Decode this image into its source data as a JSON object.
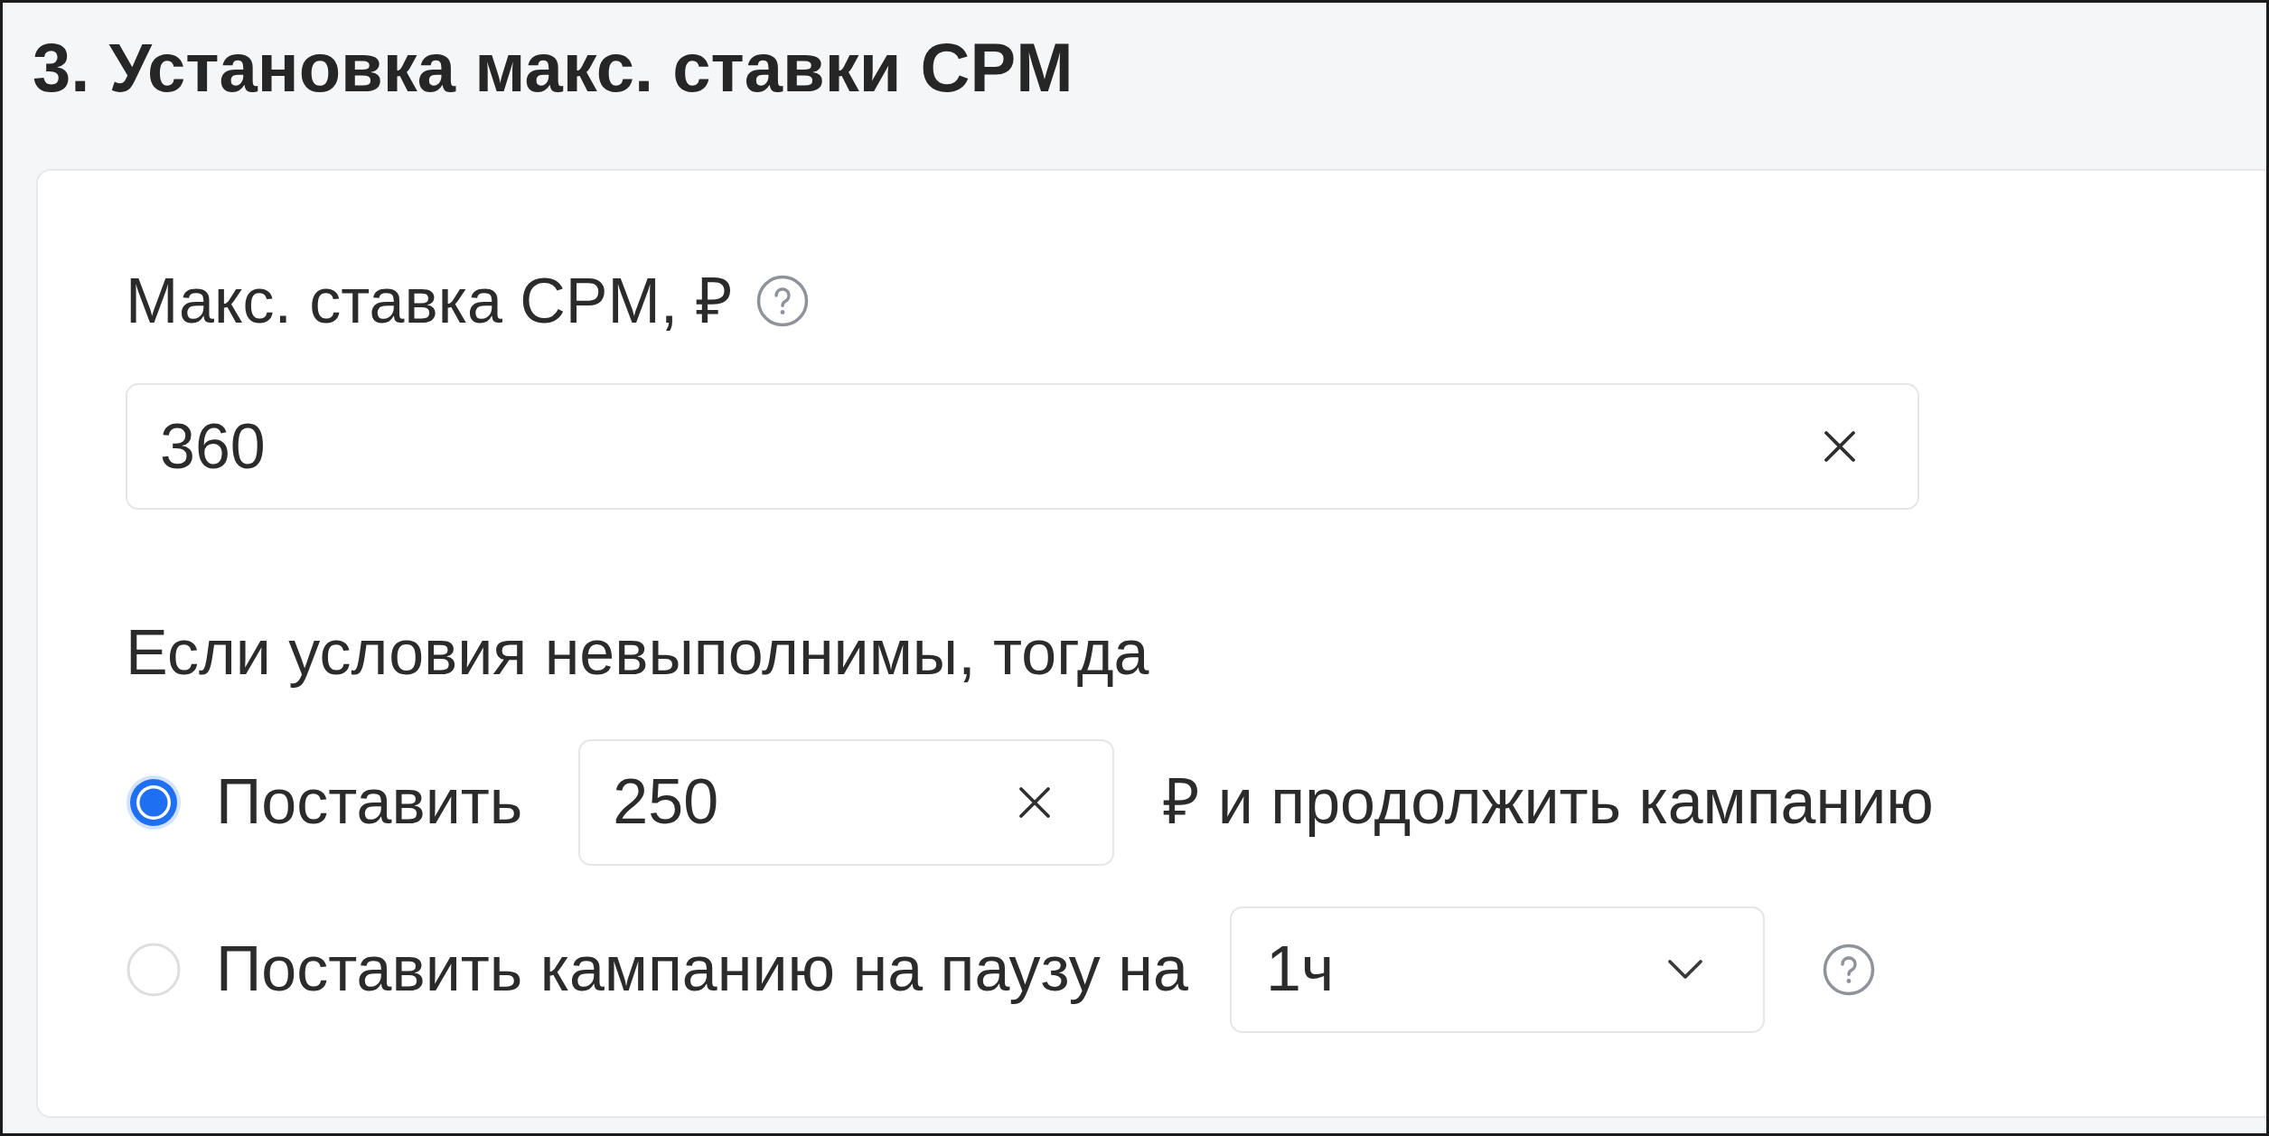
{
  "section": {
    "title": "3. Установка макс. ставки CPM"
  },
  "max_bid": {
    "label": "Макс. ставка CPM, ₽",
    "help": true,
    "value": "360"
  },
  "fallback": {
    "label": "Если условия невыполнимы, тогда",
    "options": [
      {
        "kind": "amount",
        "selected": true,
        "label": "Поставить",
        "value": "250",
        "suffix": "₽ и продолжить кампанию"
      },
      {
        "kind": "pause",
        "selected": false,
        "label": "Поставить кампанию на паузу на",
        "value": "1ч",
        "help": true
      }
    ]
  }
}
